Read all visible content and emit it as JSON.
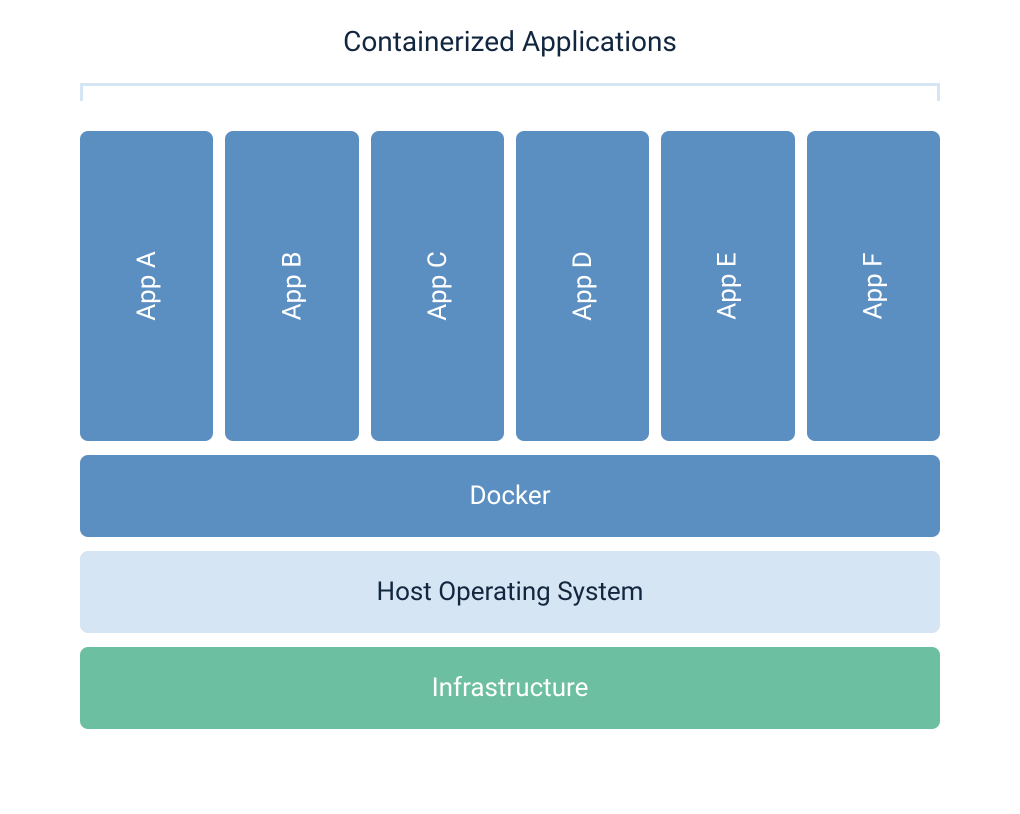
{
  "title": "Containerized Applications",
  "apps": {
    "a": "App A",
    "b": "App B",
    "c": "App C",
    "d": "App D",
    "e": "App E",
    "f": "App F"
  },
  "layers": {
    "docker": "Docker",
    "host": "Host Operating System",
    "infrastructure": "Infrastructure"
  },
  "colors": {
    "app_blue": "#5c8fc1",
    "light_blue": "#d6e5f3",
    "green": "#6cbfa1",
    "text_dark": "#12263f"
  }
}
